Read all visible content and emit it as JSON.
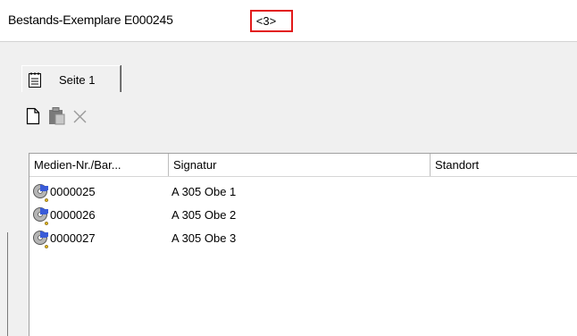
{
  "window": {
    "title": "Bestands-Exemplare E000245",
    "count_badge": "<3>"
  },
  "tabs": [
    {
      "label": "Seite 1",
      "icon": "notepad-icon"
    }
  ],
  "toolbar": {
    "buttons": [
      {
        "icon": "new-document-icon"
      },
      {
        "icon": "paste-icon"
      },
      {
        "icon": "delete-icon"
      }
    ]
  },
  "list": {
    "columns": [
      "Medien-Nr./Bar...",
      "Signatur",
      "Standort"
    ],
    "rows": [
      {
        "id": "0000025",
        "signatur": "A 305 Obe 1",
        "standort": ""
      },
      {
        "id": "0000026",
        "signatur": "A 305 Obe 2",
        "standort": ""
      },
      {
        "id": "0000027",
        "signatur": "A 305 Obe 3",
        "standort": ""
      }
    ]
  },
  "colors": {
    "highlight_border": "#e21a1a",
    "background": "#f0f0f0"
  }
}
